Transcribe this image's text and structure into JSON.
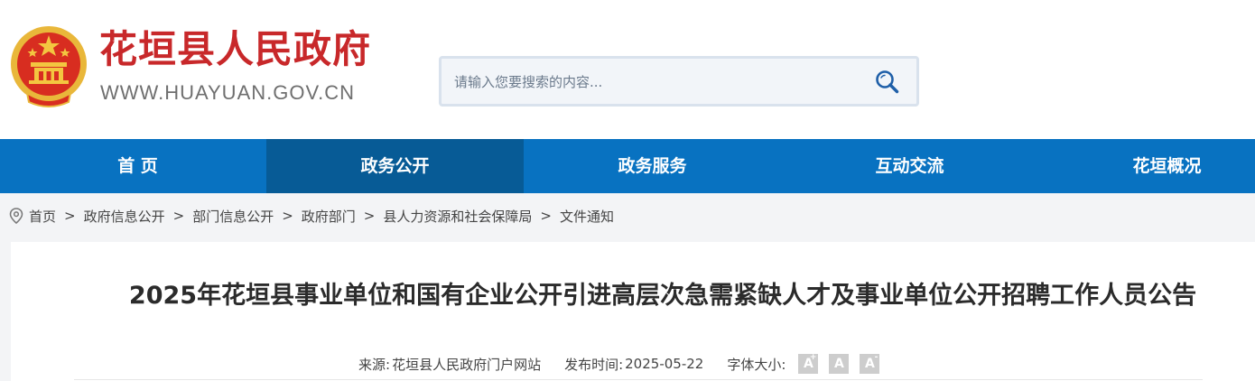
{
  "header": {
    "site_title": "花垣县人民政府",
    "site_domain": "WWW.HUAYUAN.GOV.CN",
    "brand_red": "#c8282a",
    "emblem_icon": "national-emblem-icon"
  },
  "search": {
    "placeholder": "请输入您要搜索的内容...",
    "value": "",
    "button_icon": "search-icon"
  },
  "nav": {
    "color": "#0872c1",
    "active_color": "#075b96",
    "items": [
      {
        "label": "首 页"
      },
      {
        "label": "政务公开",
        "active": true
      },
      {
        "label": "政务服务"
      },
      {
        "label": "互动交流"
      },
      {
        "label": "花垣概况"
      }
    ]
  },
  "breadcrumb": {
    "icon": "location-pin-icon",
    "separator": ">",
    "items": [
      "首页",
      "政府信息公开",
      "部门信息公开",
      "政府部门",
      "县人力资源和社会保障局",
      "文件通知"
    ]
  },
  "article": {
    "title": "2025年花垣县事业单位和国有企业公开引进高层次急需紧缺人才及事业单位公开招聘工作人员公告",
    "source_label": "来源:",
    "source_value": "花垣县人民政府门户网站",
    "date_label": "发布时间:",
    "date_value": "2025-05-22",
    "font_size_label": "字体大小:",
    "font_buttons": [
      {
        "text": "A",
        "sup": "+"
      },
      {
        "text": "A",
        "sup": ""
      },
      {
        "text": "A",
        "sup": "-"
      }
    ]
  }
}
